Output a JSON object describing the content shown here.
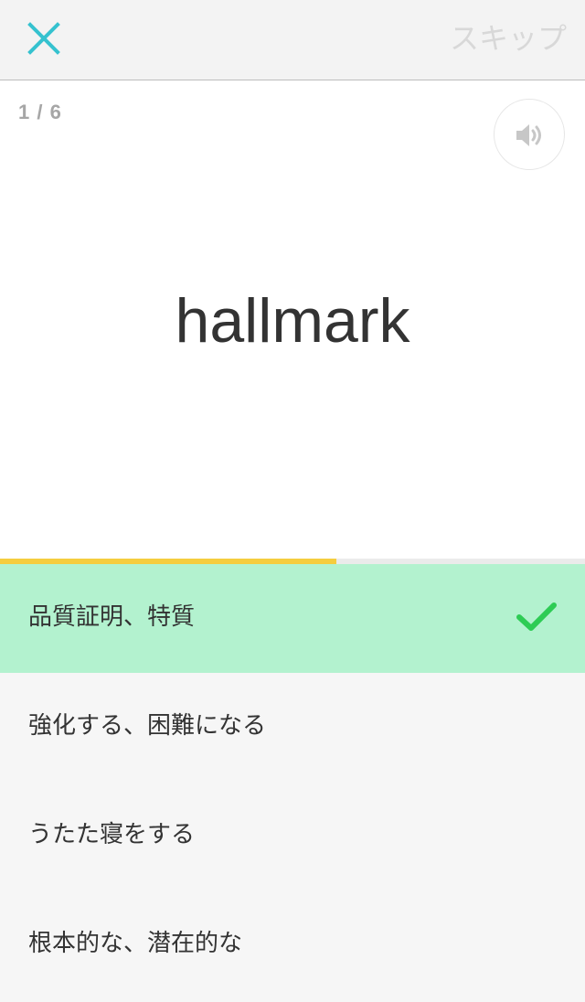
{
  "header": {
    "skip_label": "スキップ"
  },
  "card": {
    "counter": "1 / 6",
    "word": "hallmark",
    "icons": {
      "close": "close-icon",
      "sound": "speaker-icon"
    }
  },
  "progress": {
    "fraction": 0.575
  },
  "options": [
    {
      "label": "品質証明、特質",
      "state": "correct"
    },
    {
      "label": "強化する、困難になる",
      "state": "default"
    },
    {
      "label": "うたた寝をする",
      "state": "default"
    },
    {
      "label": "根本的な、潜在的な",
      "state": "default"
    }
  ],
  "colors": {
    "accent": "#35c2cf",
    "correct_bg": "#b3f2cf",
    "check": "#2ecc55",
    "progress": "#f5cd3f"
  }
}
